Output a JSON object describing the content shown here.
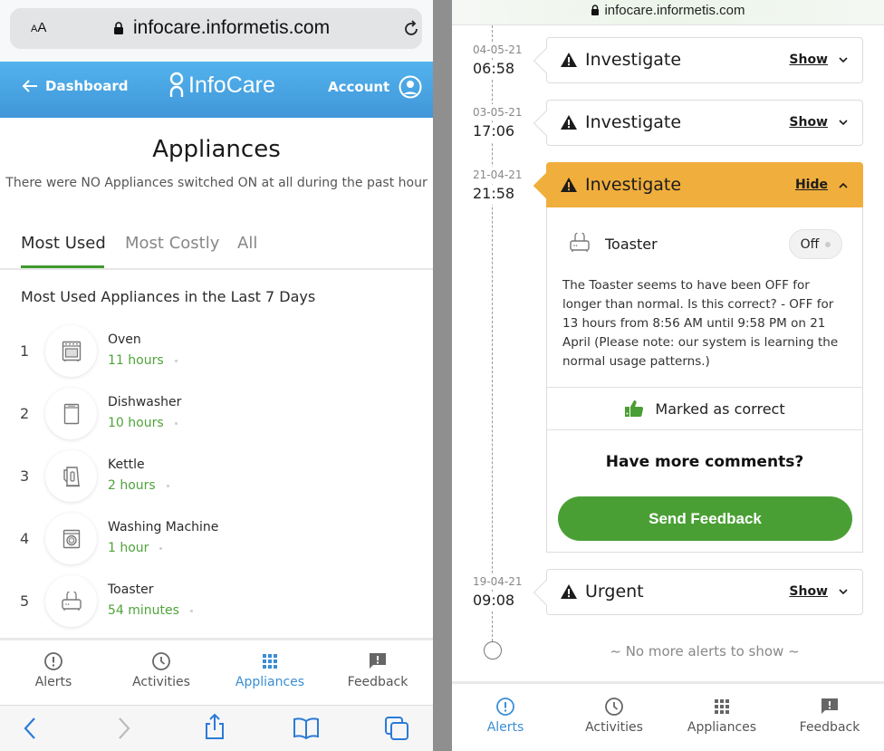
{
  "left_screen": {
    "browser": {
      "text_size_label": "AA",
      "url": "infocare.informetis.com"
    },
    "header": {
      "back_label": "Dashboard",
      "logo_text": "InfoCare",
      "account_label": "Account"
    },
    "page": {
      "title": "Appliances",
      "subtitle": "There were NO Appliances switched ON at all during the past hour"
    },
    "tabs": [
      {
        "label": "Most Used",
        "active": true
      },
      {
        "label": "Most Costly",
        "active": false
      },
      {
        "label": "All",
        "active": false
      }
    ],
    "section_title": "Most Used Appliances in the Last 7 Days",
    "appliances": [
      {
        "rank": "1",
        "name": "Oven",
        "duration": "11 hours",
        "icon": "oven-icon"
      },
      {
        "rank": "2",
        "name": "Dishwasher",
        "duration": "10 hours",
        "icon": "dishwasher-icon"
      },
      {
        "rank": "3",
        "name": "Kettle",
        "duration": "2 hours",
        "icon": "kettle-icon"
      },
      {
        "rank": "4",
        "name": "Washing Machine",
        "duration": "1 hour",
        "icon": "washing-machine-icon"
      },
      {
        "rank": "5",
        "name": "Toaster",
        "duration": "54 minutes",
        "icon": "toaster-icon"
      }
    ],
    "bottom_nav": [
      {
        "label": "Alerts",
        "icon": "alert-circle-icon",
        "active": false
      },
      {
        "label": "Activities",
        "icon": "clock-icon",
        "active": false
      },
      {
        "label": "Appliances",
        "icon": "grid-icon",
        "active": true
      },
      {
        "label": "Feedback",
        "icon": "feedback-icon",
        "active": false
      }
    ],
    "safari_toolbar": [
      "back",
      "forward",
      "share",
      "bookmarks",
      "tabs"
    ]
  },
  "right_screen": {
    "browser": {
      "url": "infocare.informetis.com"
    },
    "alerts": [
      {
        "date": "04-05-21",
        "time": "06:58",
        "title": "Investigate",
        "toggle": "Show",
        "expanded": false
      },
      {
        "date": "03-05-21",
        "time": "17:06",
        "title": "Investigate",
        "toggle": "Show",
        "expanded": false
      },
      {
        "date": "21-04-21",
        "time": "21:58",
        "title": "Investigate",
        "toggle": "Hide",
        "expanded": true
      },
      {
        "date": "19-04-21",
        "time": "09:08",
        "title": "Urgent",
        "toggle": "Show",
        "expanded": false
      }
    ],
    "detail": {
      "appliance": "Toaster",
      "state": "Off",
      "description": "The Toaster seems to have been OFF for longer than normal. Is this correct? - OFF for 13 hours from 8:56 AM until 9:58 PM on 21 April (Please note: our system is learning the normal usage patterns.)",
      "marked_label": "Marked as correct",
      "comments_prompt": "Have more comments?",
      "send_button": "Send Feedback"
    },
    "no_more": "~ No more alerts to show ~",
    "bottom_nav": [
      {
        "label": "Alerts",
        "icon": "alert-circle-icon",
        "active": true
      },
      {
        "label": "Activities",
        "icon": "clock-icon",
        "active": false
      },
      {
        "label": "Appliances",
        "icon": "grid-icon",
        "active": false
      },
      {
        "label": "Feedback",
        "icon": "feedback-icon",
        "active": false
      }
    ]
  },
  "colors": {
    "header_blue": "#4ba6e4",
    "nav_active_blue": "#3a8ed3",
    "green": "#4a9f34",
    "alert_orange": "#f0ae3d"
  }
}
